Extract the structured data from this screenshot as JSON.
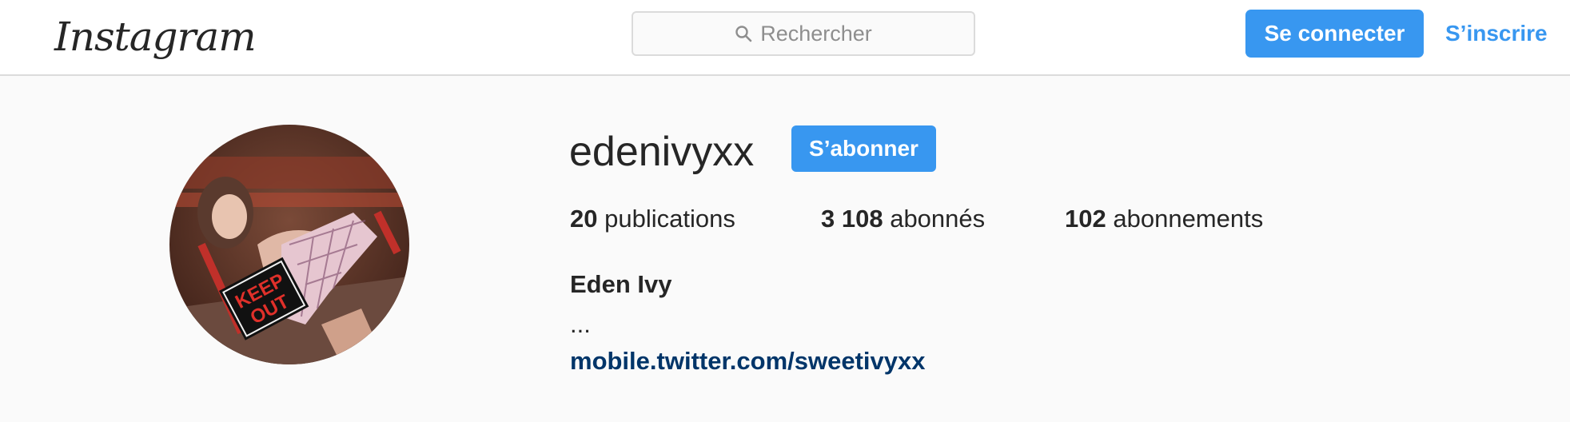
{
  "header": {
    "logo_text": "Instagram",
    "search_placeholder": "Rechercher",
    "login_label": "Se connecter",
    "signup_label": "S’inscrire"
  },
  "profile": {
    "username": "edenivyxx",
    "follow_label": "S’abonner",
    "stats": {
      "posts_count": "20",
      "posts_label": "publications",
      "followers_count": "3 108",
      "followers_label": "abonnés",
      "following_count": "102",
      "following_label": "abonnements"
    },
    "full_name": "Eden Ivy",
    "bio": "...",
    "link": "mobile.twitter.com/sweetivyxx",
    "avatar_sign_text": "KEEP OUT"
  },
  "colors": {
    "accent": "#3897f0",
    "link": "#003569",
    "text": "#262626",
    "muted": "#8e8e8e",
    "background": "#fafafa",
    "border": "#dbdbdb"
  },
  "icons": {
    "search": "search-icon",
    "avatar": "profile-photo"
  }
}
